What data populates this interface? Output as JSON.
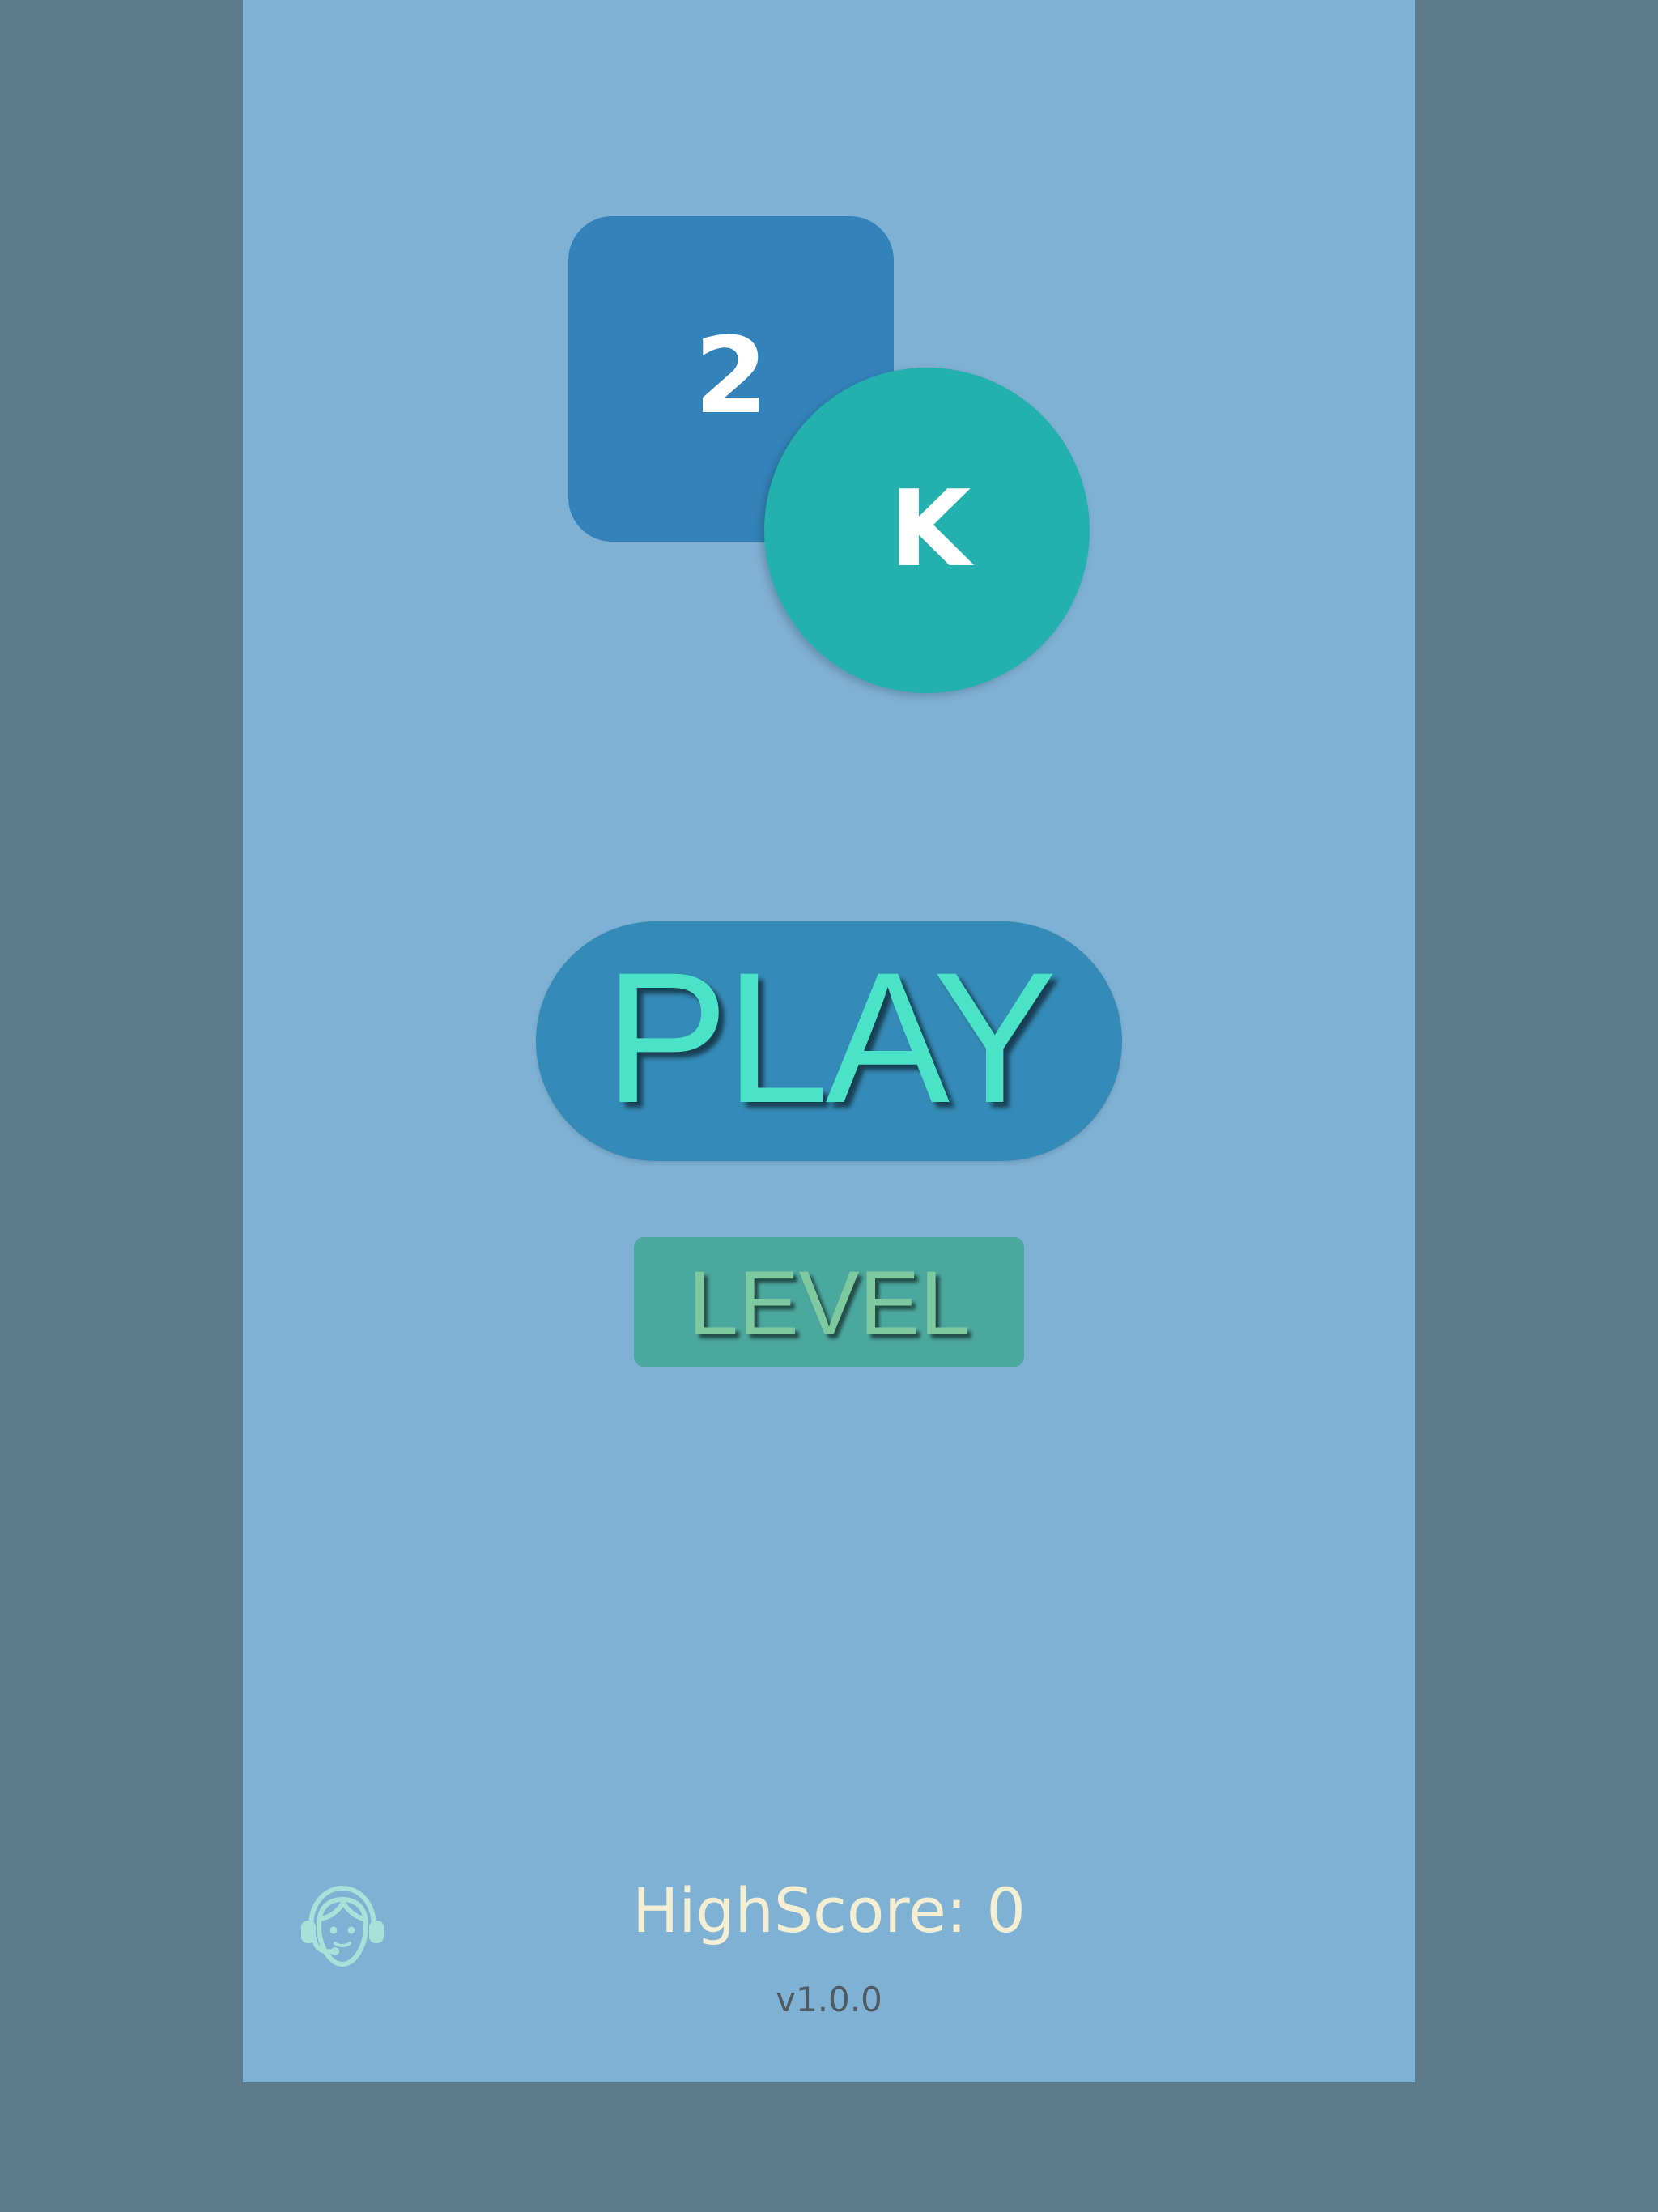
{
  "logo": {
    "square_text": "2",
    "circle_text": "K"
  },
  "menu": {
    "play_label": "PLAY",
    "level_label": "LEVEL"
  },
  "footer": {
    "support_icon": "headset-support-icon",
    "highscore": "HighScore: 0",
    "version": "v1.0.0"
  },
  "colors": {
    "outer_background": "#5e7b8b",
    "panel_background": "#7fb1d5",
    "logo_square": "#3383ba",
    "logo_circle": "#22b1ad",
    "play_button": "#358bb8",
    "play_text": "#4ae3c7",
    "level_button": "#4ba89f",
    "level_text": "#7ec99d",
    "highscore_text": "#f4eed2",
    "version_text": "#4f5a62",
    "icon": "#a7e2d8"
  }
}
